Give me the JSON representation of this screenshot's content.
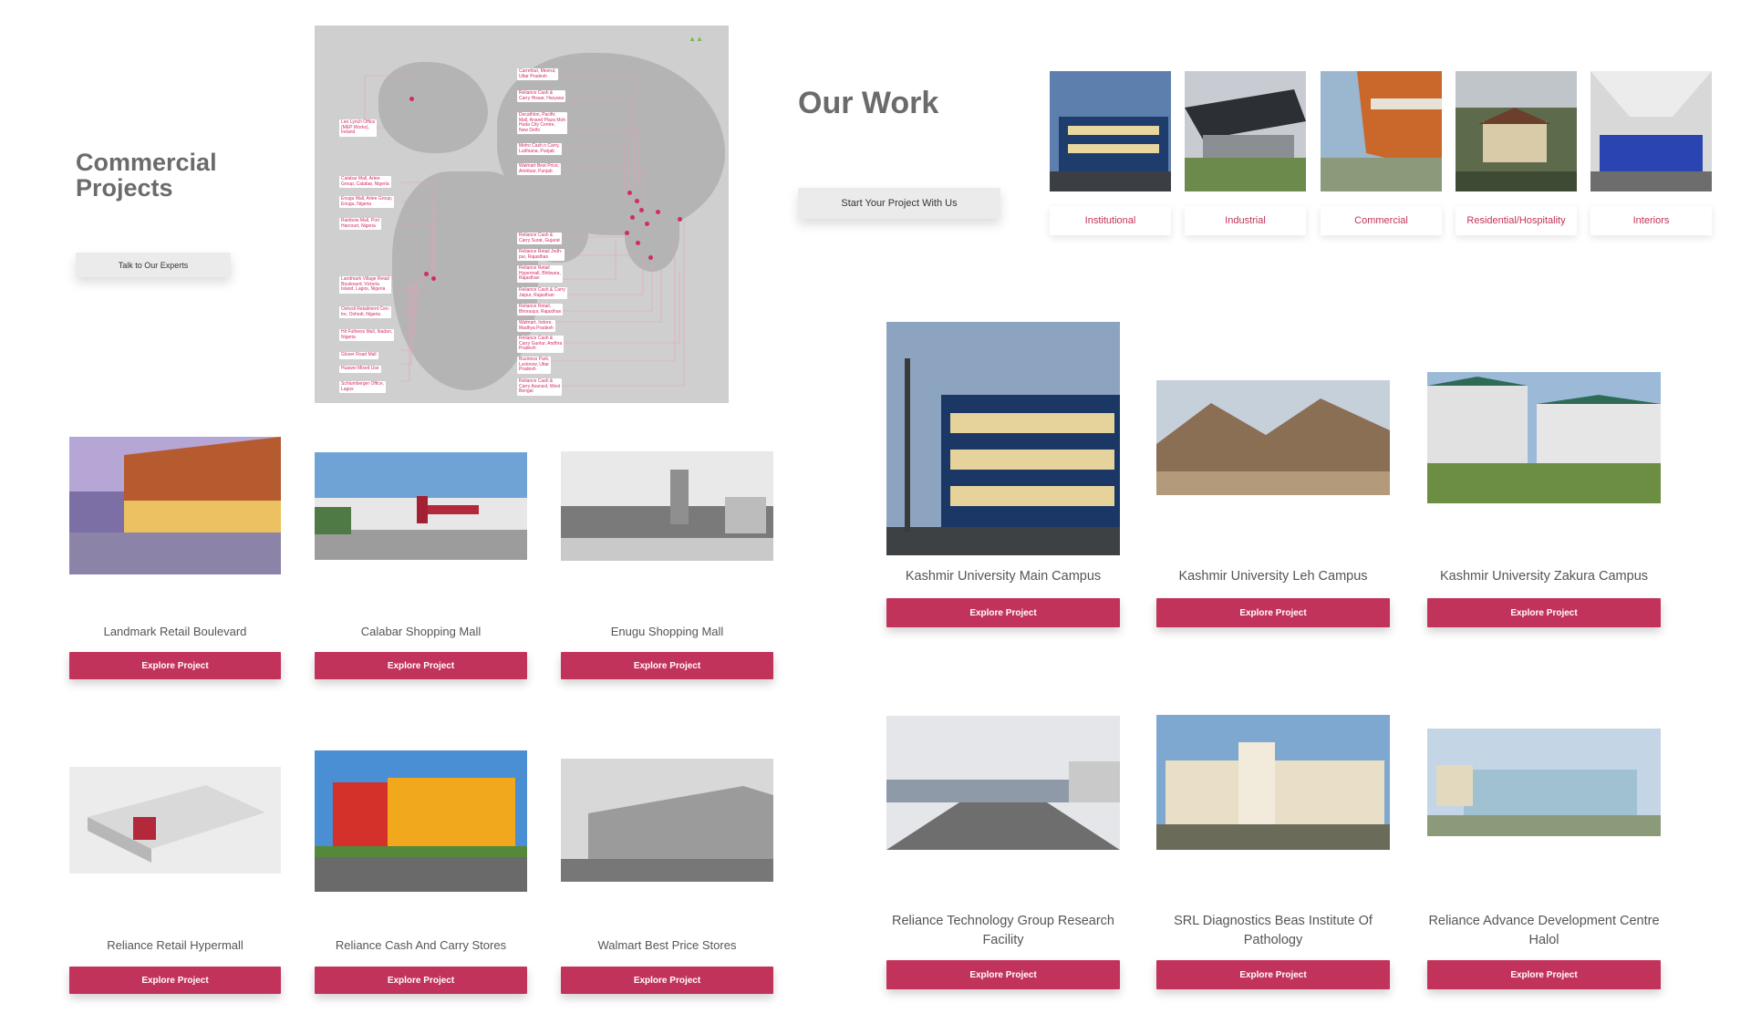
{
  "commercial": {
    "title_line1": "Commercial",
    "title_line2": "Projects",
    "cta": "Talk to Our Experts",
    "map_labels": [
      "Carrefour, Meerut,\nUttar Pradesh",
      "Reliance Cash &\nCarry Hissar, Haryana",
      "Decathlon, Pacific\nMall, Anand Plaza Moh\nHuda City Centre,\nNew Delhi",
      "Metro Cash n Carry,\nLudhiana, Punjab",
      "Walmart Best Price,\nAmritsar, Punjab",
      "Leo Lynch Office\n(MEP Works),\nIreland",
      "Calabar Mall, Artee\nGroup, Calabar, Nigeria",
      "Enugu Mall, Artee Group,\nEnugu, Nigeria",
      "Rainbow Mall, Port\nHarcourt, Nigeria",
      "Reliance Cash &\nCarry Surat, Gujarat",
      "Reliance Retail Jodh-\npur, Rajasthan",
      "Reliance Retail\nHypermall, Bhilwara,\nRajasthan",
      "Reliance Cash & Carry\nJaipur, Rajasthan",
      "Reliance Retail,\nBhorasjur, Rajasthan",
      "Walmart, Indore,\nMadhya Pradesh",
      "Reliance Cash &\nCarry Guntur, Andhra\nPradesh",
      "Business Park,\nLucknow, Uttar\nPradesh",
      "Reliance Cash &\nCarry Asansol, West\nBengal",
      "Landmark Village Retail\nBoulevard, Victoria\nIsland, Lagos, Nigeria",
      "Oshodi Retailment Cen-\ntre, Oshodi, Nigeria",
      "Hit Fullness Mall, Ibadan,\nNigeria",
      "Glover Road Mall",
      "Huawei Mixed Use",
      "Schlumberger Office,\nLagos"
    ],
    "projects": [
      {
        "name": "Landmark Retail Boulevard",
        "button": "Explore Project"
      },
      {
        "name": "Calabar Shopping Mall",
        "button": "Explore Project"
      },
      {
        "name": "Enugu Shopping Mall",
        "button": "Explore Project"
      },
      {
        "name": "Reliance Retail Hypermall",
        "button": "Explore Project"
      },
      {
        "name": "Reliance Cash And Carry Stores",
        "button": "Explore Project"
      },
      {
        "name": "Walmart Best Price Stores",
        "button": "Explore Project"
      }
    ]
  },
  "our_work": {
    "title": "Our Work",
    "cta": "Start Your Project With Us",
    "categories": [
      "Institutional",
      "Industrial",
      "Commercial",
      "Residential/Hospitality",
      "Interiors"
    ],
    "projects": [
      {
        "name": "Kashmir University Main Campus",
        "button": "Explore Project"
      },
      {
        "name": "Kashmir University Leh Campus",
        "button": "Explore Project"
      },
      {
        "name": "Kashmir University Zakura Campus",
        "button": "Explore Project"
      },
      {
        "name": "Reliance Technology Group Research Facility",
        "button": "Explore Project"
      },
      {
        "name": "SRL Diagnostics Beas Institute Of Pathology",
        "button": "Explore Project"
      },
      {
        "name": "Reliance Advance Development Centre Halol",
        "button": "Explore Project"
      }
    ]
  },
  "colors": {
    "accent": "#c2335b",
    "heading": "#6b6b6b",
    "button_gray": "#ebebeb",
    "map_pin": "#d42b63"
  }
}
